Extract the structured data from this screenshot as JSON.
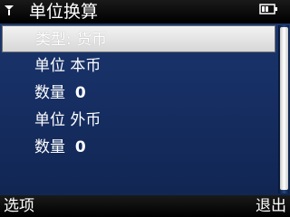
{
  "app": {
    "title": "单位换算",
    "status_icons": [
      "signal-icon",
      "battery-icon"
    ]
  },
  "list": {
    "items": [
      {
        "label": "类型: 货币",
        "selected": true
      },
      {
        "label": "单位  本币",
        "selected": false
      },
      {
        "label": "数量",
        "value": "0",
        "selected": false
      },
      {
        "label": "单位  外币",
        "selected": false
      },
      {
        "label": "数量",
        "value": "0",
        "selected": false
      }
    ]
  },
  "softkeys": {
    "left": "选项",
    "right": "退出"
  },
  "colors": {
    "background": "#173066",
    "highlight": "#e5e5e5",
    "text": "#ffffff"
  }
}
